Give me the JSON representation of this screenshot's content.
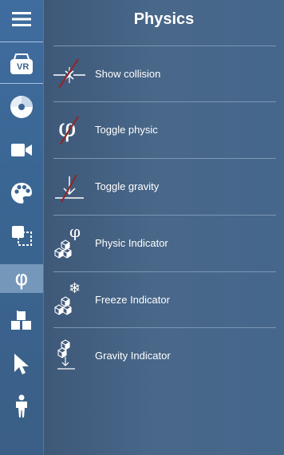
{
  "header": {
    "title": "Physics"
  },
  "sidebar": {
    "items": [
      {
        "name": "menu",
        "icon": "hamburger-menu-icon"
      },
      {
        "name": "vr",
        "icon": "vr-headset-icon",
        "text": "VR"
      },
      {
        "name": "disc",
        "icon": "disc-icon"
      },
      {
        "name": "camera",
        "icon": "video-camera-icon"
      },
      {
        "name": "palette",
        "icon": "palette-icon"
      },
      {
        "name": "transform",
        "icon": "scale-squares-icon"
      },
      {
        "name": "physics",
        "icon": "phi-icon",
        "text": "φ",
        "active": true
      },
      {
        "name": "objects",
        "icon": "cubes-icon"
      },
      {
        "name": "select",
        "icon": "pointer-icon"
      },
      {
        "name": "avatar",
        "icon": "person-icon"
      }
    ]
  },
  "menu": {
    "items": [
      {
        "label": "Show collision",
        "icon": "show-collision-icon"
      },
      {
        "label": "Toggle physic",
        "icon": "toggle-physic-icon",
        "glyph": "φ"
      },
      {
        "label": "Toggle gravity",
        "icon": "toggle-gravity-icon"
      },
      {
        "label": "Physic Indicator",
        "icon": "physic-indicator-icon",
        "glyph": "φ"
      },
      {
        "label": "Freeze Indicator",
        "icon": "freeze-indicator-icon",
        "glyph": "❄"
      },
      {
        "label": "Gravity Indicator",
        "icon": "gravity-indicator-icon"
      }
    ]
  },
  "colors": {
    "accent_strike": "#8b2a2a",
    "text": "#ffffff",
    "active_bg": "#b9d1ea"
  }
}
